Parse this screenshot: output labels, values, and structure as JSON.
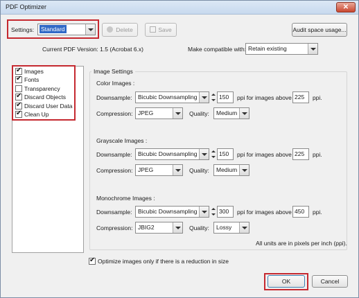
{
  "window": {
    "title": "PDF Optimizer",
    "close_glyph": "✕"
  },
  "top": {
    "settings_label": "Settings:",
    "settings_value": "Standard",
    "delete_label": "Delete",
    "save_label": "Save",
    "audit_label": "Audit space usage..."
  },
  "compat": {
    "current_version": "Current PDF Version: 1.5 (Acrobat 6.x)",
    "make_label": "Make compatible with:",
    "make_value": "Retain existing"
  },
  "panels": [
    {
      "label": "Images",
      "checked": true
    },
    {
      "label": "Fonts",
      "checked": true
    },
    {
      "label": "Transparency",
      "checked": false
    },
    {
      "label": "Discard Objects",
      "checked": true
    },
    {
      "label": "Discard User Data",
      "checked": true
    },
    {
      "label": "Clean Up",
      "checked": true
    }
  ],
  "image_settings": {
    "title": "Image Settings",
    "color": {
      "heading": "Color Images :",
      "downsample_label": "Downsample:",
      "downsample_value": "Bicubic Downsampling to",
      "ppi_value": "150",
      "above_label": "ppi for images above",
      "above_value": "225",
      "ppi_suffix": "ppi.",
      "compression_label": "Compression:",
      "compression_value": "JPEG",
      "quality_label": "Quality:",
      "quality_value": "Medium"
    },
    "gray": {
      "heading": "Grayscale Images :",
      "downsample_label": "Downsample:",
      "downsample_value": "Bicubic Downsampling to",
      "ppi_value": "150",
      "above_label": "ppi for images above",
      "above_value": "225",
      "ppi_suffix": "ppi.",
      "compression_label": "Compression:",
      "compression_value": "JPEG",
      "quality_label": "Quality:",
      "quality_value": "Medium"
    },
    "mono": {
      "heading": "Monochrome Images :",
      "downsample_label": "Downsample:",
      "downsample_value": "Bicubic Downsampling to",
      "ppi_value": "300",
      "above_label": "ppi for images above",
      "above_value": "450",
      "ppi_suffix": "ppi.",
      "compression_label": "Compression:",
      "compression_value": "JBIG2",
      "quality_label": "Quality:",
      "quality_value": "Lossy"
    },
    "units_note": "All units are in pixels per inch (ppi).",
    "optimize_label": "Optimize images only if there is a reduction in size",
    "optimize_checked": true
  },
  "footer": {
    "ok_label": "OK",
    "cancel_label": "Cancel"
  },
  "colors": {
    "highlight_red": "#c5282f",
    "selection_blue": "#3169c6"
  }
}
